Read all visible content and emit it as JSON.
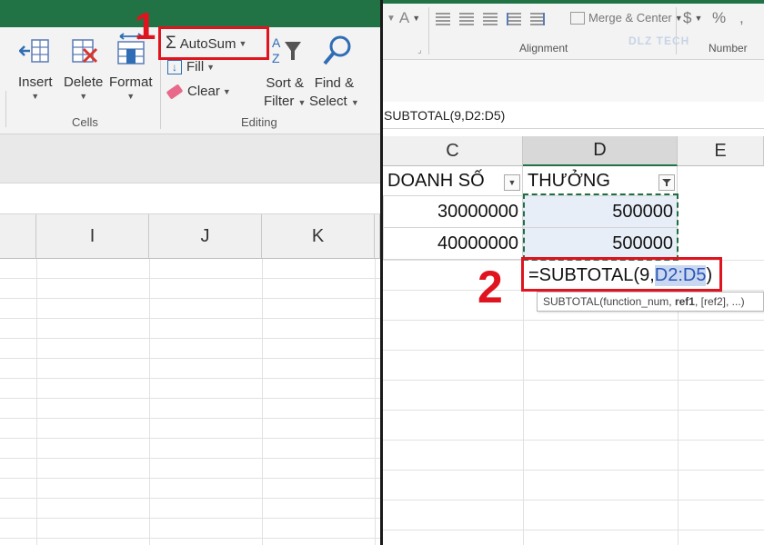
{
  "left_panel": {
    "ribbon": {
      "cells_group": {
        "label": "Cells",
        "insert": "Insert",
        "delete": "Delete",
        "format": "Format"
      },
      "editing_group": {
        "label": "Editing",
        "autosum": "AutoSum",
        "fill": "Fill",
        "clear": "Clear",
        "sort_filter_line1": "Sort &",
        "sort_filter_line2": "Filter",
        "find_select_line1": "Find &",
        "find_select_line2": "Select"
      }
    },
    "step_badge": "1",
    "columns": [
      "I",
      "J",
      "K"
    ]
  },
  "right_panel": {
    "ribbon": {
      "font_color_letter": "A",
      "merge_center": "Merge & Center",
      "alignment_label": "Alignment",
      "currency_symbol": "$",
      "percent_symbol": "%",
      "number_label": "Number",
      "watermark": "DLZ TECH"
    },
    "formula_bar": "SUBTOTAL(9,D2:D5)",
    "columns": [
      "C",
      "D",
      "E"
    ],
    "table": {
      "headers": [
        "DOANH SỐ",
        "THƯỞNG"
      ],
      "rows": [
        [
          "30000000",
          "500000"
        ],
        [
          "40000000",
          "500000"
        ]
      ]
    },
    "formula_cell": {
      "prefix": "=SUBTOTAL(9,",
      "ref": "D2:D5",
      "suffix": ")"
    },
    "tooltip": {
      "text_start": "SUBTOTAL(function_num, ",
      "text_bold": "ref1",
      "text_end": ", [ref2], ...)"
    },
    "step_badge": "2"
  },
  "colors": {
    "excel_green": "#217346",
    "highlight_red": "#e0141e",
    "selected_fill": "#e8eef8",
    "reference_blue": "#2a56b8"
  }
}
